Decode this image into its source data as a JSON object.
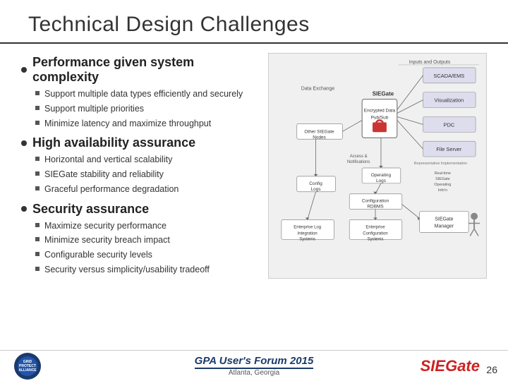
{
  "slide": {
    "title": "Technical Design Challenges",
    "sections": [
      {
        "id": "performance",
        "header": "Performance given system complexity",
        "bullets": [
          "Support multiple data types efficiently and securely",
          "Support multiple priorities",
          "Minimize latency and maximize throughput"
        ]
      },
      {
        "id": "availability",
        "header": "High availability assurance",
        "bullets": [
          "Horizontal and vertical scalability",
          "SIEGate stability and reliability",
          "Graceful performance degradation"
        ]
      },
      {
        "id": "security",
        "header": "Security assurance",
        "bullets": [
          "Maximize security performance",
          "Minimize security breach impact",
          "Configurable security levels",
          "Security versus simplicity/usability tradeoff"
        ]
      }
    ],
    "footer": {
      "event": "GPA User's Forum 2015",
      "location": "Atlanta, Georgia",
      "brand": "SIEGate",
      "page": "26",
      "logo_lines": [
        "GRID",
        "PROTECTION",
        "ALLIANCE"
      ]
    }
  }
}
